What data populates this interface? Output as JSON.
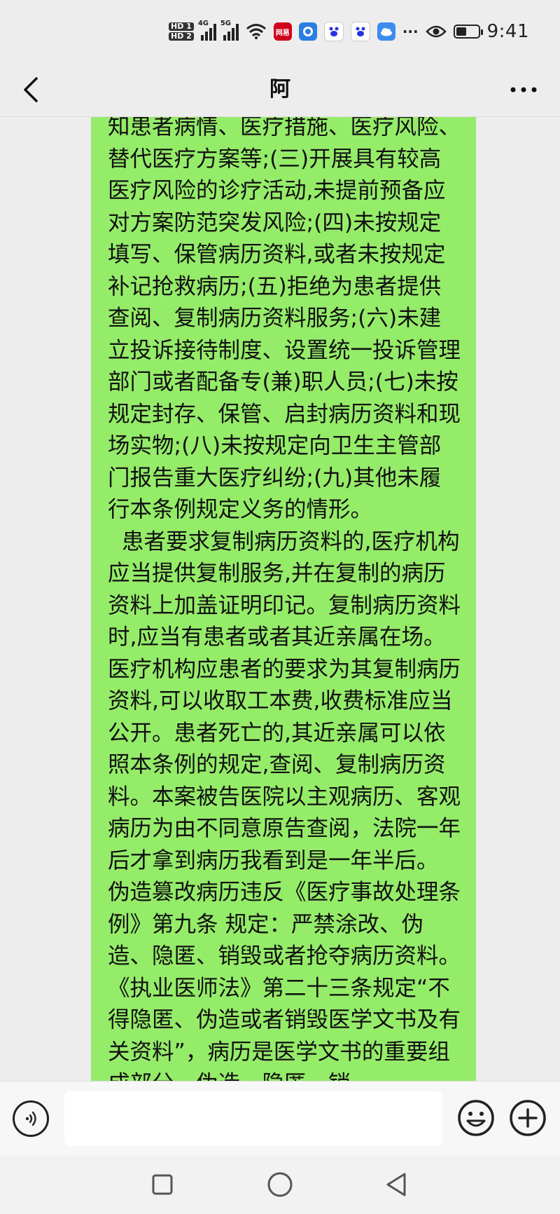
{
  "status_bar": {
    "hd1": "HD 1",
    "hd2": "HD 2",
    "net1": "4G",
    "net2": "5G",
    "app_badge": "网易",
    "more_dots": "···",
    "time": "9:41",
    "battery_level": 0.45
  },
  "header": {
    "title": "阿"
  },
  "message": {
    "text": "知患者病情、医疗措施、医疗风险、替代医疗方案等;(三)开展具有较高医疗风险的诊疗活动,未提前预备应对方案防范突发风险;(四)未按规定填写、保管病历资料,或者未按规定补记抢救病历;(五)拒绝为患者提供查阅、复制病历资料服务;(六)未建立投诉接待制度、设置统一投诉管理部门或者配备专(兼)职人员;(七)未按规定封存、保管、启封病历资料和现场实物;(八)未按规定向卫生主管部门报告重大医疗纠纷;(九)其他未履行本条例规定义务的情形。\n  患者要求复制病历资料的,医疗机构应当提供复制服务,并在复制的病历资料上加盖证明印记。复制病历资料时,应当有患者或者其近亲属在场。医疗机构应患者的要求为其复制病历资料,可以收取工本费,收费标准应当公开。患者死亡的,其近亲属可以依照本条例的规定,查阅、复制病历资料。本案被告医院以主观病历、客观病历为由不同意原告查阅，法院一年后才拿到病历我看到是一年半后。   伪造篡改病历违反《医疗事故处理条例》第九条 规定：严禁涂改、伪造、隐匿、销毁或者抢夺病历资料。《执业医师法》第二十三条规定“不得隐匿、伪造或者销毁医学文书及有关资料”，病历是医学文书的重要组成部分，伪造、隐匿、销"
  },
  "input_bar": {
    "value": "",
    "placeholder": ""
  },
  "colors": {
    "bubble": "#95ec69",
    "background": "#ededed"
  },
  "icons": [
    "back-icon",
    "more-icon",
    "voice-icon",
    "emoji-icon",
    "plus-icon",
    "square-icon",
    "circle-icon",
    "triangle-back-icon"
  ]
}
